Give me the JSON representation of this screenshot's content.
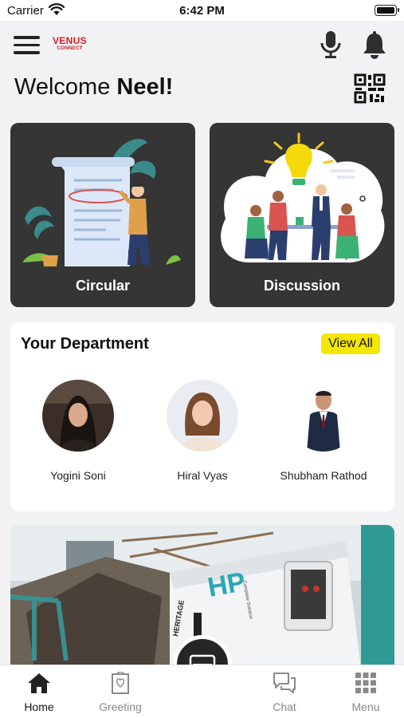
{
  "status_bar": {
    "carrier": "Carrier",
    "time": "6:42 PM"
  },
  "brand": {
    "line1": "VENUS",
    "line2": "CONNECT",
    "color": "#d81f26"
  },
  "welcome": {
    "prefix": "Welcome ",
    "name": "Neel!"
  },
  "tiles": [
    {
      "label": "Circular",
      "icon": "document-illustration"
    },
    {
      "label": "Discussion",
      "icon": "team-meeting-illustration"
    }
  ],
  "department": {
    "title": "Your Department",
    "view_all": "View All",
    "members": [
      {
        "name": "Yogini Soni"
      },
      {
        "name": "Hiral Vyas"
      },
      {
        "name": "Shubham Rathod"
      }
    ]
  },
  "banner": {
    "brand_text": "HERITAGE",
    "logo": "HP",
    "sub": "Complete Solution"
  },
  "tabs": [
    {
      "label": "Home",
      "icon": "home-icon",
      "active": true
    },
    {
      "label": "Greeting",
      "icon": "greeting-card-icon"
    },
    {
      "label": "Chat",
      "icon": "chat-icon"
    },
    {
      "label": "Menu",
      "icon": "grid-menu-icon"
    }
  ],
  "colors": {
    "accent": "#f5e600",
    "tile_bg": "#353535",
    "page_bg": "#f2f2f4"
  }
}
